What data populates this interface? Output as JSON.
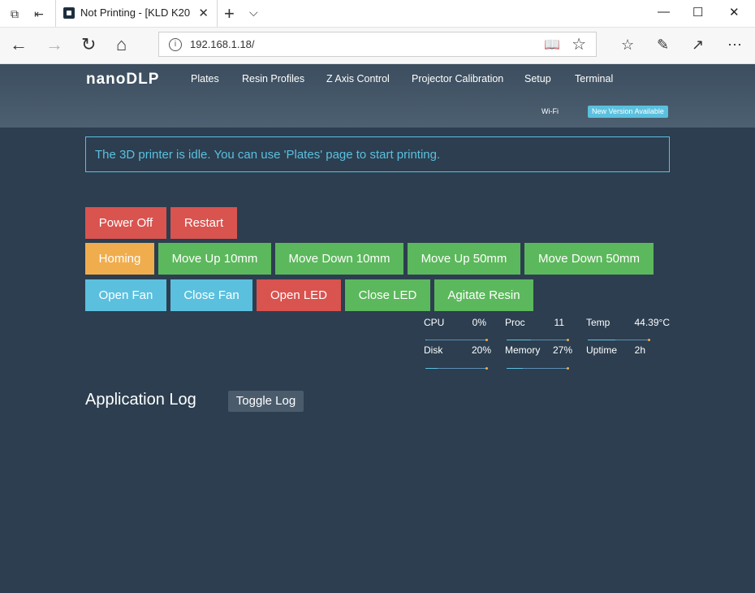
{
  "browser": {
    "tab_title": "Not Printing - [KLD K20",
    "url": "192.168.1.18/"
  },
  "app": {
    "logo": "nanoDLP",
    "nav": [
      "Plates",
      "Resin Profiles",
      "Z Axis Control",
      "Projector Calibration",
      "Setup",
      "Terminal"
    ],
    "wifi": "Wi-Fi",
    "new_version": "New Version Available"
  },
  "alert": {
    "message": "The 3D printer is idle. You can use 'Plates' page to start printing."
  },
  "buttons": {
    "power_off": "Power Off",
    "restart": "Restart",
    "homing": "Homing",
    "move_up_10": "Move Up 10mm",
    "move_down_10": "Move Down 10mm",
    "move_up_50": "Move Up 50mm",
    "move_down_50": "Move Down 50mm",
    "open_fan": "Open Fan",
    "close_fan": "Close Fan",
    "open_led": "Open LED",
    "close_led": "Close LED",
    "agitate_resin": "Agitate Resin"
  },
  "stats": {
    "cpu": {
      "label": "CPU",
      "value": "0%"
    },
    "proc": {
      "label": "Proc",
      "value": "11"
    },
    "temp": {
      "label": "Temp",
      "value": "44.39°C"
    },
    "disk": {
      "label": "Disk",
      "value": "20%"
    },
    "memory": {
      "label": "Memory",
      "value": "27%"
    },
    "uptime": {
      "label": "Uptime",
      "value": "2h"
    }
  },
  "log": {
    "title": "Application Log",
    "toggle": "Toggle Log"
  },
  "colors": {
    "background": "#2c3e50",
    "danger": "#d9534f",
    "warning": "#f0ad4e",
    "success": "#5cb85c",
    "info": "#5bc0de"
  }
}
